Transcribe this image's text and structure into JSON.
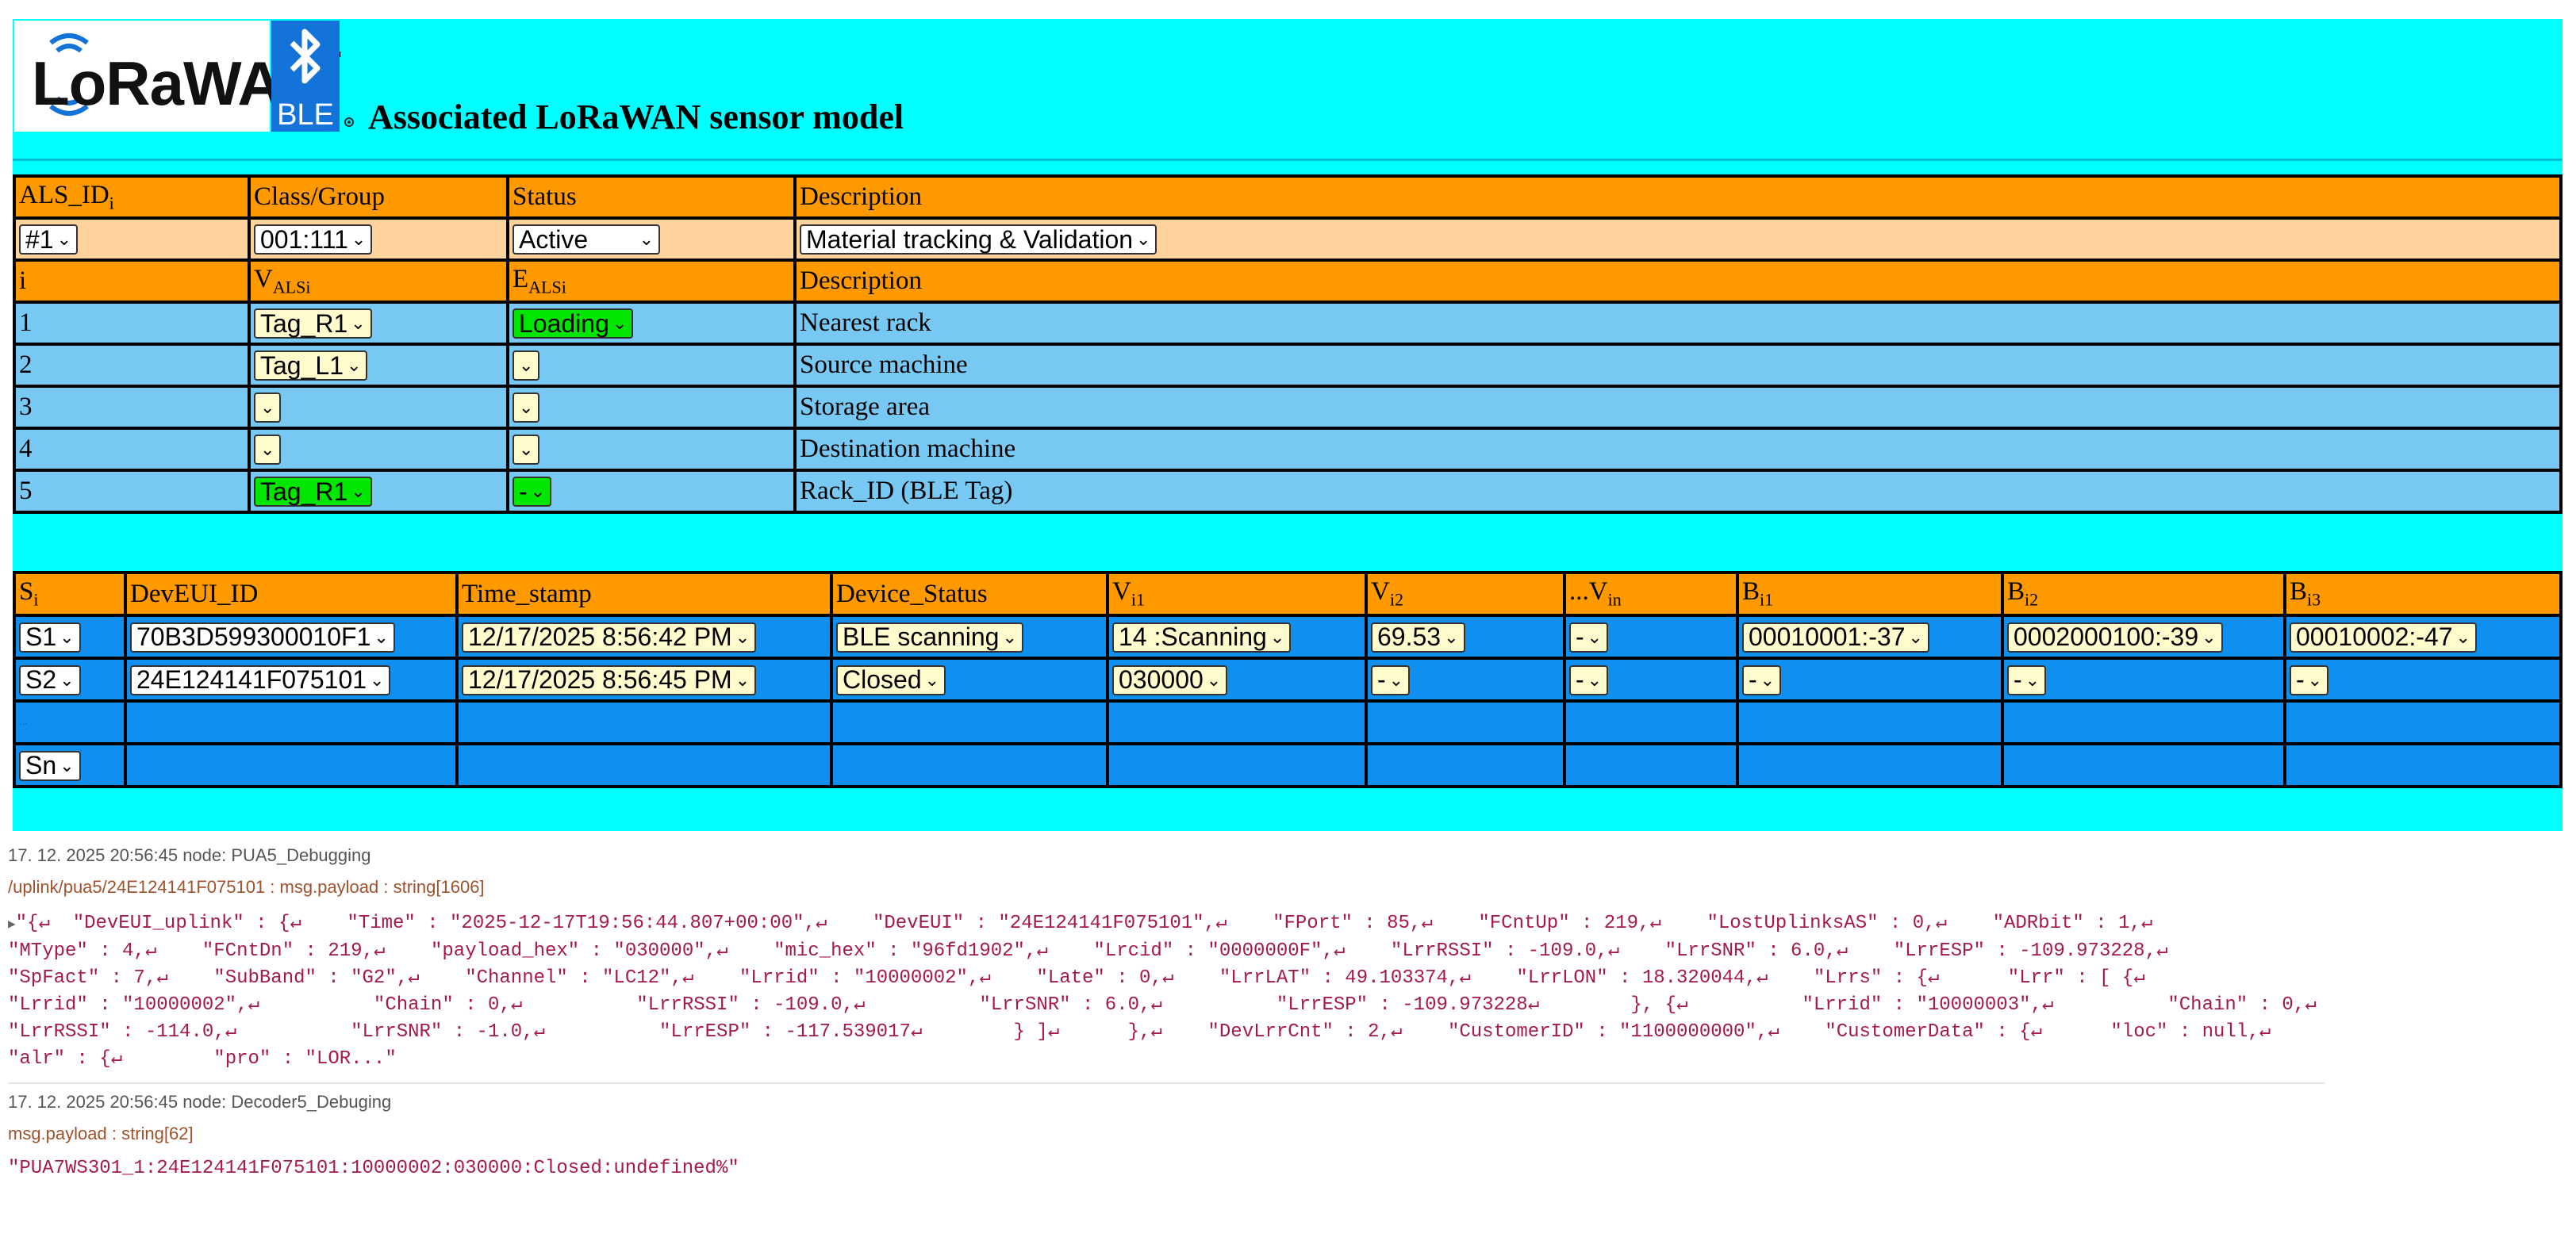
{
  "colors": {
    "panel_bg": "#00ffff",
    "header_orange": "#ff9900",
    "peach_row": "#ffd39b",
    "light_blue_row": "#78c8f4",
    "device_blue_row": "#0f8ff0",
    "select_yellow": "#fffbcc",
    "select_green": "#00e600",
    "payload_text": "#a6194d"
  },
  "header": {
    "logo_text": "LoRaWAN",
    "logo_tm": "™",
    "ble_logo_text": "BLE",
    "title": "Associated LoRaWAN sensor model"
  },
  "als_table": {
    "col_als_id": "ALS_ID",
    "col_als_id_sub": "i",
    "col_class_group": "Class/Group",
    "col_status": "Status",
    "col_description": "Description",
    "als_id_value": "#1",
    "class_group_value": "001:111",
    "status_value": "Active",
    "description_value": "Material tracking & Validation",
    "col_i": "i",
    "col_v": "V",
    "col_v_sub": "ALSi",
    "col_e": "E",
    "col_e_sub": "ALSi",
    "col_description2": "Description",
    "rows": [
      {
        "i": "1",
        "v": "Tag_R1",
        "e": "Loading",
        "description": "Nearest rack"
      },
      {
        "i": "2",
        "v": "Tag_L1",
        "e": "",
        "description": "Source machine"
      },
      {
        "i": "3",
        "v": "",
        "e": "",
        "description": "Storage area"
      },
      {
        "i": "4",
        "v": "",
        "e": "",
        "description": "Destination machine"
      },
      {
        "i": "5",
        "v": "Tag_R1",
        "e": "-",
        "description": "Rack_ID (BLE Tag)"
      }
    ]
  },
  "device_table": {
    "col_s": "S",
    "col_s_sub": "i",
    "col_deveui": "DevEUI_ID",
    "col_time": "Time_stamp",
    "col_status": "Device_Status",
    "col_v1": "V",
    "col_v1_sub": "i1",
    "col_v2": "V",
    "col_v2_sub": "i2",
    "col_vn": "...V",
    "col_vn_sub": "in",
    "col_b1": "B",
    "col_b1_sub": "i1",
    "col_b2": "B",
    "col_b2_sub": "i2",
    "col_b3": "B",
    "col_b3_sub": "i3",
    "rows": [
      {
        "s": "S1",
        "deveui": "70B3D599300010F1",
        "time": "12/17/2025 8:56:42 PM",
        "status": "BLE scanning",
        "v1": "14 :Scanning",
        "v2": "69.53",
        "vn": "-",
        "b1": "00010001:-37",
        "b2": "0002000100:-39",
        "b3": "00010002:-47"
      },
      {
        "s": "S2",
        "deveui": "24E124141F075101",
        "time": "12/17/2025 8:56:45 PM",
        "status": "Closed",
        "v1": "030000",
        "v2": "-",
        "vn": "-",
        "b1": "-",
        "b2": "-",
        "b3": "-"
      }
    ],
    "ellipsis_row": "...",
    "last_row_s": "Sn"
  },
  "debug_log": [
    {
      "meta": "17. 12. 2025 20:56:45   node: PUA5_Debugging",
      "path": "/uplink/pua5/24E124141F075101 : msg.payload : string[1606]",
      "payload_lines": [
        "\"{↵  \"DevEUI_uplink\" : {↵    \"Time\" : \"2025-12-17T19:56:44.807+00:00\",↵    \"DevEUI\" : \"24E124141F075101\",↵    \"FPort\" : 85,↵    \"FCntUp\" : 219,↵    \"LostUplinksAS\" : 0,↵    \"ADRbit\" : 1,↵",
        "\"MType\" : 4,↵    \"FCntDn\" : 219,↵    \"payload_hex\" : \"030000\",↵    \"mic_hex\" : \"96fd1902\",↵    \"Lrcid\" : \"0000000F\",↵    \"LrrRSSI\" : -109.0,↵    \"LrrSNR\" : 6.0,↵    \"LrrESP\" : -109.973228,↵",
        "\"SpFact\" : 7,↵    \"SubBand\" : \"G2\",↵    \"Channel\" : \"LC12\",↵    \"Lrrid\" : \"10000002\",↵    \"Late\" : 0,↵    \"LrrLAT\" : 49.103374,↵    \"LrrLON\" : 18.320044,↵    \"Lrrs\" : {↵      \"Lrr\" : [ {↵",
        "\"Lrrid\" : \"10000002\",↵          \"Chain\" : 0,↵          \"LrrRSSI\" : -109.0,↵          \"LrrSNR\" : 6.0,↵          \"LrrESP\" : -109.973228↵        }, {↵          \"Lrrid\" : \"10000003\",↵          \"Chain\" : 0,↵",
        "\"LrrRSSI\" : -114.0,↵          \"LrrSNR\" : -1.0,↵          \"LrrESP\" : -117.539017↵        } ]↵      },↵    \"DevLrrCnt\" : 2,↵    \"CustomerID\" : \"1100000000\",↵    \"CustomerData\" : {↵      \"loc\" : null,↵",
        "\"alr\" : {↵        \"pro\" : \"LOR...\""
      ]
    },
    {
      "meta": "17. 12. 2025 20:56:45   node: Decoder5_Debuging",
      "path": "msg.payload : string[62]",
      "payload_lines": [
        "\"PUA7WS301_1:24E124141F075101:10000002:030000:Closed:undefined%\""
      ]
    }
  ]
}
